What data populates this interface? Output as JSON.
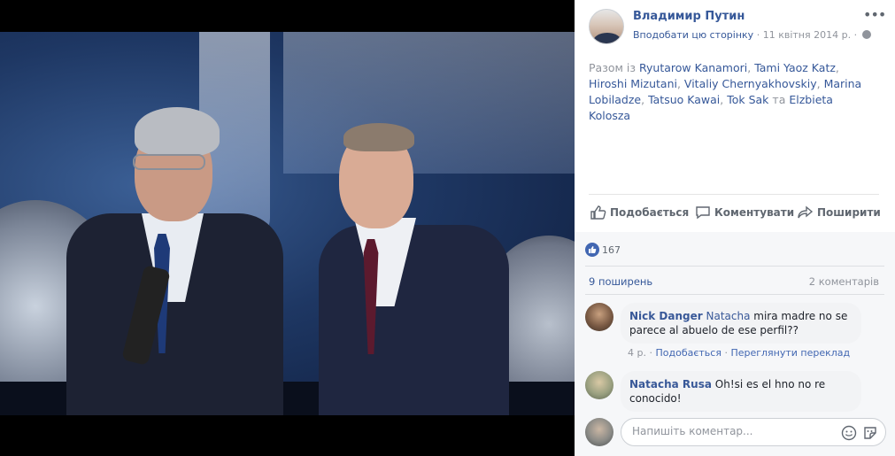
{
  "post": {
    "author": "Владимир Путин",
    "like_page": "Вподобати цю сторінку",
    "date": "11 квітня 2014 р.",
    "separator": "·",
    "with_prefix": "Разом із",
    "tagged": [
      "Ryutarow Kanamori",
      "Tami Yaoz Katz",
      "Hiroshi Mizutani",
      "Vitaliy Chernyakhovskiy",
      "Marina Lobiladze",
      "Tatsuo Kawai",
      "Tok Sak"
    ],
    "with_conjunction": "та",
    "tagged_last": "Elzbieta Kolosza"
  },
  "actions": {
    "like": "Подобається",
    "comment": "Коментувати",
    "share": "Поширити"
  },
  "stats": {
    "reactions": "167",
    "shares": "9 поширень",
    "comments": "2 коментарів"
  },
  "comments": [
    {
      "name": "Nick Danger",
      "tag": "Natacha",
      "text_line1": " mira madre no se",
      "text_line2": "parece al abuelo de ese perfil??",
      "time": "4 р.",
      "sep": "·",
      "like": "Подобається",
      "translate": "Переглянути переклад"
    },
    {
      "name": "Natacha Rusa",
      "text_line1": "Oh!si es el hno no re",
      "text_line2": "conocido!"
    }
  ],
  "composer": {
    "placeholder": "Напишіть коментар..."
  },
  "colors": {
    "link": "#365899",
    "accent": "#4267b2",
    "muted": "#90949c"
  },
  "icons": [
    "more-options-icon",
    "globe-icon",
    "thumbs-up-icon",
    "comment-icon",
    "share-icon",
    "like-reaction-icon",
    "emoji-icon",
    "sticker-icon"
  ]
}
